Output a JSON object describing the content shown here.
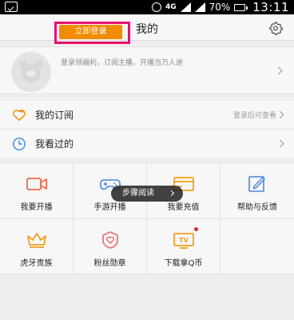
{
  "status_bar": {
    "network": "4G",
    "battery": "70%",
    "time": "13:11"
  },
  "header": {
    "title": "我的"
  },
  "login": {
    "hint": "登录领福利，订阅主播，开播当万人迷",
    "button": "立即登录"
  },
  "rows": [
    {
      "label": "我的订阅",
      "side": "登录后可查看",
      "icon": "heart-plus-icon"
    },
    {
      "label": "我看过的",
      "side": "",
      "icon": "clock-icon"
    }
  ],
  "grid": [
    {
      "label": "我要开播",
      "icon": "camera-icon"
    },
    {
      "label": "手游开播",
      "icon": "gamepad-icon"
    },
    {
      "label": "我要充值",
      "icon": "card-icon"
    },
    {
      "label": "帮助与反馈",
      "icon": "edit-icon"
    },
    {
      "label": "虎牙贵族",
      "icon": "crown-icon"
    },
    {
      "label": "粉丝勋章",
      "icon": "medal-icon"
    },
    {
      "label": "下载拿Q币",
      "icon": "tv-icon"
    }
  ],
  "tooltip": {
    "label": "步骤阅读"
  },
  "colors": {
    "accent": "#f08c00",
    "highlight": "#e8106e"
  }
}
